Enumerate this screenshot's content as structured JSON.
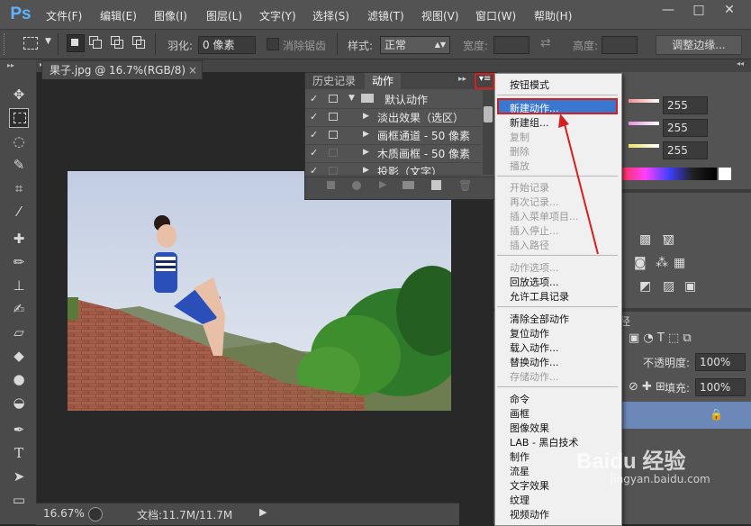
{
  "app": {
    "logo": "Ps"
  },
  "menubar": {
    "items": [
      "文件(F)",
      "编辑(E)",
      "图像(I)",
      "图层(L)",
      "文字(Y)",
      "选择(S)",
      "滤镜(T)",
      "视图(V)",
      "窗口(W)",
      "帮助(H)"
    ]
  },
  "window_controls": {
    "minimize": "—",
    "maximize": "□",
    "close": "✕"
  },
  "options_bar": {
    "feather_label": "羽化:",
    "feather_value": "0 像素",
    "antialias_label": "消除锯齿",
    "style_label": "样式:",
    "style_value": "正常",
    "width_label": "宽度:",
    "height_label": "高度:",
    "refine_edge_button": "调整边缘..."
  },
  "document": {
    "tab_title": "果子.jpg @ 16.7%(RGB/8)",
    "tab_close": "×"
  },
  "status_bar": {
    "zoom": "16.67%",
    "doc_info": "文档:11.7M/11.7M"
  },
  "actions_panel": {
    "tabs": [
      "历史记录",
      "动作"
    ],
    "rows": [
      {
        "label": "默认动作",
        "type": "set"
      },
      {
        "label": "淡出效果（选区）",
        "type": "action"
      },
      {
        "label": "画框通道 - 50 像素",
        "type": "action"
      },
      {
        "label": "木质画框 - 50 像素",
        "type": "action"
      },
      {
        "label": "投影（文字）",
        "type": "action"
      }
    ]
  },
  "right_panels": {
    "color_values": [
      "255",
      "255",
      "255"
    ],
    "opacity_label": "不透明度:",
    "opacity_value": "100%",
    "fill_label": "填充:",
    "fill_value": "100%",
    "paths_tab": "径"
  },
  "flyout_menu": {
    "sections": [
      [
        {
          "label": "按钮模式",
          "enabled": true
        }
      ],
      [
        {
          "label": "新建动作...",
          "enabled": true,
          "highlighted": true
        },
        {
          "label": "新建组...",
          "enabled": true
        },
        {
          "label": "复制",
          "enabled": false
        },
        {
          "label": "删除",
          "enabled": false
        },
        {
          "label": "播放",
          "enabled": false
        }
      ],
      [
        {
          "label": "开始记录",
          "enabled": false
        },
        {
          "label": "再次记录...",
          "enabled": false
        },
        {
          "label": "插入菜单项目...",
          "enabled": false
        },
        {
          "label": "插入停止...",
          "enabled": false
        },
        {
          "label": "插入路径",
          "enabled": false
        }
      ],
      [
        {
          "label": "动作选项...",
          "enabled": false
        },
        {
          "label": "回放选项...",
          "enabled": true
        },
        {
          "label": "允许工具记录",
          "enabled": true
        }
      ],
      [
        {
          "label": "清除全部动作",
          "enabled": true
        },
        {
          "label": "复位动作",
          "enabled": true
        },
        {
          "label": "载入动作...",
          "enabled": true
        },
        {
          "label": "替换动作...",
          "enabled": true
        },
        {
          "label": "存储动作...",
          "enabled": false
        }
      ],
      [
        {
          "label": "命令",
          "enabled": true
        },
        {
          "label": "画框",
          "enabled": true
        },
        {
          "label": "图像效果",
          "enabled": true
        },
        {
          "label": "LAB - 黑白技术",
          "enabled": true
        },
        {
          "label": "制作",
          "enabled": true
        },
        {
          "label": "流星",
          "enabled": true
        },
        {
          "label": "文字效果",
          "enabled": true
        },
        {
          "label": "纹理",
          "enabled": true
        },
        {
          "label": "视频动作",
          "enabled": true
        }
      ]
    ]
  },
  "watermark": {
    "text": "Baidu 经验",
    "url": "jingyan.baidu.com"
  },
  "colors": {
    "highlight_box": "#d42020",
    "menu_selected": "#3a78d0",
    "arrow": "#d42020"
  }
}
